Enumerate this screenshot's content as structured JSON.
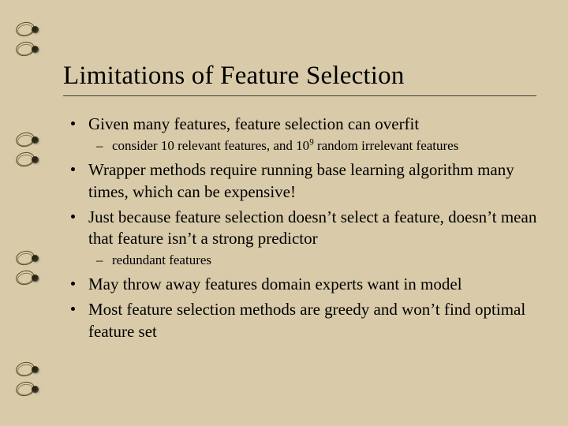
{
  "title": "Limitations of Feature Selection",
  "items": [
    {
      "text": "Given many features, feature selection can overfit",
      "sub": [
        {
          "text_html": "consider 10 relevant features, and 10<sup>9</sup> random irrelevant features"
        }
      ]
    },
    {
      "text": "Wrapper methods require running base learning algorithm many times, which can be expensive!"
    },
    {
      "text": "Just because feature selection doesn’t select a feature, doesn’t mean that feature isn’t a strong predictor",
      "sub": [
        {
          "text": "redundant features"
        }
      ]
    },
    {
      "text": "May throw away features domain experts want in model"
    },
    {
      "text": "Most feature selection methods are greedy and won’t find optimal feature set"
    }
  ],
  "ring_positions": [
    30,
    55,
    170,
    195,
    320,
    345,
    461,
    486
  ]
}
